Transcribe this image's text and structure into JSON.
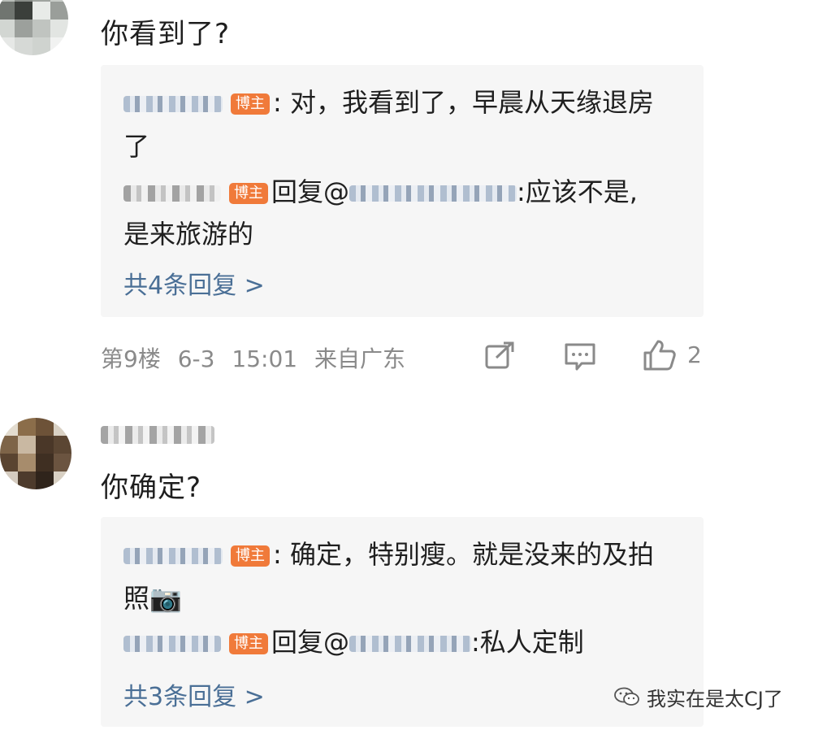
{
  "comment1": {
    "text": "你看到了?",
    "reply1": {
      "badge": "博主",
      "text_line1": ": 对，我看到了，早晨从天缘退房",
      "text_line2": "了"
    },
    "reply2": {
      "badge": "博主",
      "prefix": "回复@",
      "text_line1": ":应该不是,",
      "text_line2": "是来旅游的"
    },
    "more_replies": "共4条回复 >",
    "meta": {
      "floor": "第9楼",
      "date": "6-3",
      "time": "15:01",
      "location": "来自广东"
    },
    "like_count": "2"
  },
  "comment2": {
    "text": "你确定?",
    "reply1": {
      "badge": "博主",
      "text_line1": ": 确定，特别瘦。就是没来的及拍",
      "text_line2": "照📷"
    },
    "reply2": {
      "badge": "博主",
      "prefix": "回复@",
      "text": ":私人定制"
    },
    "more_replies": "共3条回复 >"
  },
  "watermark": {
    "text": "我实在是太CJ了",
    "icon": "wechat-icon"
  },
  "colors": {
    "badge": "#f07a3a",
    "link": "#4a6f96",
    "meta": "#8a8a8a",
    "reply_bg": "#f6f6f6"
  }
}
